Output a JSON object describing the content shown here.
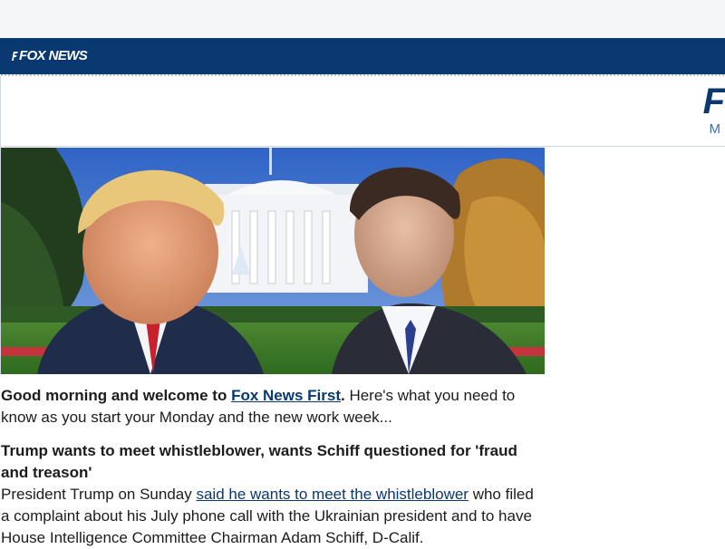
{
  "header": {
    "logo_text": "FOX NEWS",
    "masthead_initial": "F",
    "masthead_sub": "M"
  },
  "hero": {
    "image_description": "photo-collage-trump-schiff-white-house"
  },
  "intro": {
    "lead_bold": "Good morning and welcome to ",
    "link_text": "Fox News First",
    "period": ".",
    "rest": " Here's what you need to know as you start your Monday and the new work week..."
  },
  "story": {
    "headline": "Trump wants to meet whistleblower, wants Schiff questioned for 'fraud and treason'",
    "body_start": "President Trump on Sunday ",
    "body_link": "said he wants to meet the whistleblower",
    "body_rest": " who filed a complaint about his July phone call with the Ukrainian president and to have House Intelligence Committee Chairman Adam Schiff, D-Calif."
  },
  "colors": {
    "brand_navy": "#0a3871",
    "link_blue": "#0a3871",
    "accent_blue": "#3d6fb5"
  }
}
